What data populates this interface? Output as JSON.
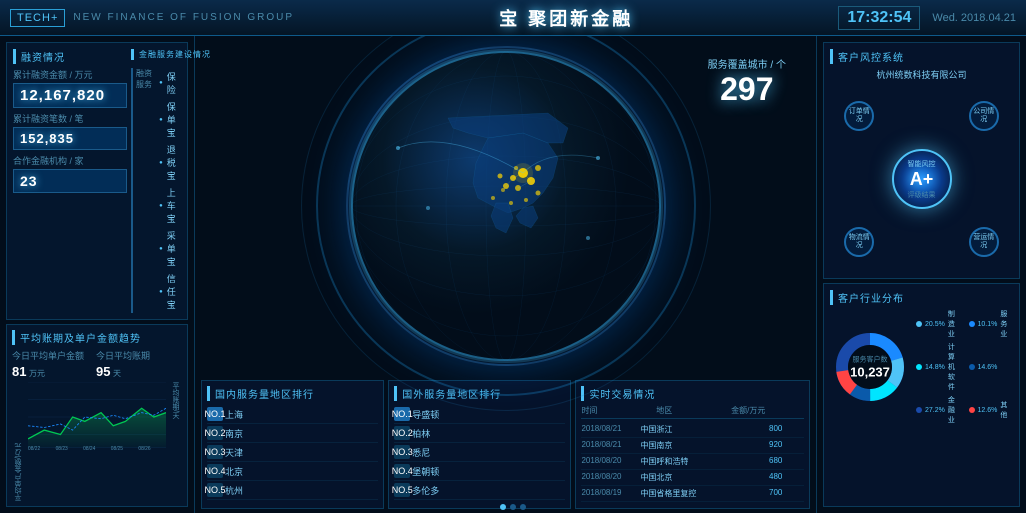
{
  "header": {
    "tech_badge": "TECH+",
    "subtitle": "NEW FINANCE OF FUSION GROUP",
    "title": "聚团新金融",
    "title_icon": "宝",
    "time": "17:32:54",
    "date": "Wed. 2018.04.21"
  },
  "left": {
    "funding_title": "融资情况",
    "service_title": "金融服务建设情况",
    "total_amount_label": "累计融资金额 / 万元",
    "total_amount_value": "12,167,820",
    "total_count_label": "累计融资笔数 / 笔",
    "total_count_value": "152,835",
    "partner_label": "合作金融机构 / 家",
    "partner_value": "23",
    "finance_items": [
      "融资服务"
    ],
    "service_items": [
      "保险",
      "保单宝",
      "退税宝",
      "上车宝",
      "采单宝",
      "信任宝"
    ],
    "chart_title": "平均账期及单户金额趋势",
    "avg_amount_label": "今日平均单户金额",
    "avg_amount_value": "81",
    "avg_amount_unit": "万元",
    "avg_period_label": "今日平均账期",
    "avg_period_value": "95",
    "avg_period_unit": "天",
    "chart_y1_label": "平均单户金额/万元",
    "chart_y2_label": "平均账期/天",
    "chart_x_labels": [
      "08/22",
      "08/23",
      "08/24",
      "08/25",
      "08/26"
    ],
    "chart_y1_max": "800",
    "chart_y2_max": "120"
  },
  "center": {
    "service_cities_label": "服务覆盖城市 / 个",
    "service_cities_value": "297",
    "domestic_ranking_title": "国内服务量地区排行",
    "domestic_items": [
      {
        "rank": "NO.1",
        "city": "上海"
      },
      {
        "rank": "NO.2",
        "city": "南京"
      },
      {
        "rank": "NO.3",
        "city": "天津"
      },
      {
        "rank": "NO.4",
        "city": "北京"
      },
      {
        "rank": "NO.5",
        "city": "杭州"
      }
    ],
    "overseas_ranking_title": "国外服务量地区排行",
    "overseas_items": [
      {
        "rank": "NO.1",
        "city": "导盛顿"
      },
      {
        "rank": "NO.2",
        "city": "柏林"
      },
      {
        "rank": "NO.3",
        "city": "悉尼"
      },
      {
        "rank": "NO.4",
        "city": "堡朝顿"
      },
      {
        "rank": "NO.5",
        "city": "多伦多"
      }
    ],
    "realtime_title": "实时交易情况",
    "realtime_col_time": "时间",
    "realtime_col_region": "地区",
    "realtime_col_amount": "金额/万元",
    "realtime_items": [
      {
        "time": "2018/08/21",
        "region": "中国浙江",
        "amount": "800"
      },
      {
        "time": "2018/08/21",
        "region": "中国南京",
        "amount": "920"
      },
      {
        "time": "2018/08/20",
        "region": "中国呼和浩特",
        "amount": "680"
      },
      {
        "time": "2018/08/20",
        "region": "中国北京",
        "amount": "480"
      },
      {
        "time": "2018/08/19",
        "region": "中国省格里复控",
        "amount": "700"
      }
    ]
  },
  "right": {
    "risk_title": "客户风控系统",
    "company_name": "杭州统数科技有限公司",
    "risk_items": [
      {
        "label": "订单情况",
        "pos": "top-left"
      },
      {
        "label": "智能风控",
        "pos": "center"
      },
      {
        "label": "公司情况",
        "pos": "top-right"
      },
      {
        "label": "物流情况",
        "pos": "bottom-left"
      },
      {
        "label": "营运情况",
        "pos": "bottom-right"
      }
    ],
    "ai_grade": "A+",
    "ai_label": "智能风控",
    "ai_result_label": "评级结果",
    "industry_title": "客户行业分布",
    "customer_total_label": "服务客户数",
    "customer_total_value": "10,237",
    "legend": [
      {
        "label": "制造业",
        "pct": "20.5%",
        "color": "#4fc3f7"
      },
      {
        "label": "服务业",
        "pct": "10.1%",
        "color": "#1a8aff"
      },
      {
        "label": "计算机软件",
        "pct": "14.8%",
        "color": "#00e5ff"
      },
      {
        "label": "14.6%",
        "pct": "14.6%",
        "color": "#0a5aaa"
      },
      {
        "label": "金融业",
        "pct": "27.2%",
        "color": "#1a4aaa"
      },
      {
        "label": "其他",
        "pct": "12.6%",
        "color": "#ff4444"
      }
    ]
  }
}
